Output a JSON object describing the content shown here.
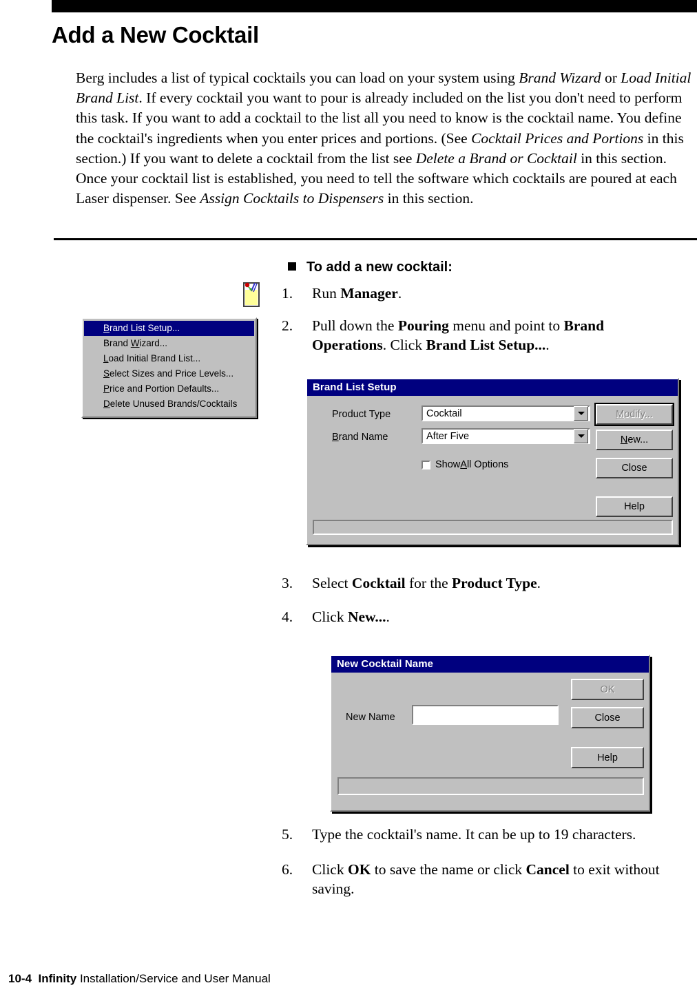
{
  "document": {
    "title": "Add a New Cocktail",
    "intro_segments": [
      {
        "text": "Berg includes a list of typical cocktails you can load on your system using ",
        "style": "normal"
      },
      {
        "text": "Brand Wizard",
        "style": "italic"
      },
      {
        "text": " or ",
        "style": "normal"
      },
      {
        "text": "Load Initial Brand List",
        "style": "italic"
      },
      {
        "text": ". If every cocktail you want to pour is already included on the list you don't need to perform this task. If you want to add a cocktail to the list all you need to know is the cocktail name. You define the cocktail's ingredients when you enter prices and portions. (See ",
        "style": "normal"
      },
      {
        "text": "Cocktail Prices and Portions",
        "style": "italic"
      },
      {
        "text": " in this section.) If you want to delete a cocktail from the list see ",
        "style": "normal"
      },
      {
        "text": "Delete a Brand or Cocktail",
        "style": "italic"
      },
      {
        "text": " in this section. Once your cocktail list is established, you need to tell the software which cocktails are poured at each Laser dispenser. See ",
        "style": "normal"
      },
      {
        "text": "Assign Cocktails to Dispensers",
        "style": "italic"
      },
      {
        "text": " in this section.",
        "style": "normal"
      }
    ]
  },
  "procedure": {
    "heading": "To add a new cocktail:",
    "steps": [
      {
        "number": "1.",
        "segments": [
          {
            "text": "Run ",
            "style": "normal"
          },
          {
            "text": "Manager",
            "style": "bold"
          },
          {
            "text": ".",
            "style": "normal"
          }
        ]
      },
      {
        "number": "2.",
        "segments": [
          {
            "text": "Pull down the ",
            "style": "normal"
          },
          {
            "text": "Pouring",
            "style": "bold"
          },
          {
            "text": " menu and point to ",
            "style": "normal"
          },
          {
            "text": "Brand Operations",
            "style": "bold"
          },
          {
            "text": ". Click ",
            "style": "normal"
          },
          {
            "text": "Brand List Setup...",
            "style": "bold"
          },
          {
            "text": ".",
            "style": "normal"
          }
        ]
      },
      {
        "number": "3.",
        "segments": [
          {
            "text": "Select ",
            "style": "normal"
          },
          {
            "text": "Cocktail",
            "style": "bold"
          },
          {
            "text": " for the ",
            "style": "normal"
          },
          {
            "text": "Product Type",
            "style": "bold"
          },
          {
            "text": ".",
            "style": "normal"
          }
        ]
      },
      {
        "number": "4.",
        "segments": [
          {
            "text": "Click ",
            "style": "normal"
          },
          {
            "text": "New...",
            "style": "bold"
          },
          {
            "text": ".",
            "style": "normal"
          }
        ]
      },
      {
        "number": "5.",
        "segments": [
          {
            "text": "Type the cocktail's name. It can be up to 19 characters.",
            "style": "normal"
          }
        ]
      },
      {
        "number": "6.",
        "segments": [
          {
            "text": "Click ",
            "style": "normal"
          },
          {
            "text": "OK",
            "style": "bold"
          },
          {
            "text": " to save the name or click ",
            "style": "normal"
          },
          {
            "text": "Cancel",
            "style": "bold"
          },
          {
            "text": " to exit without saving.",
            "style": "normal"
          }
        ]
      }
    ]
  },
  "menu_screenshot": {
    "items": [
      {
        "accel": "B",
        "rest": "rand List Setup...",
        "selected": true
      },
      {
        "pre": "Brand ",
        "accel": "W",
        "rest": "izard...",
        "selected": false
      },
      {
        "accel": "L",
        "rest": "oad Initial Brand List...",
        "selected": false
      },
      {
        "accel": "S",
        "rest": "elect Sizes and Price Levels...",
        "selected": false
      },
      {
        "accel": "P",
        "rest": "rice and Portion Defaults...",
        "selected": false
      },
      {
        "accel": "D",
        "rest": "elete Unused Brands/Cocktails",
        "selected": false
      }
    ]
  },
  "brand_list_setup_dialog": {
    "title": "Brand List Setup",
    "product_type_label": "Product Type",
    "product_type_value": "Cocktail",
    "brand_name_label_accel": "B",
    "brand_name_label_rest": "rand Name",
    "brand_name_value": "After Five",
    "show_all_options_pre": "Show ",
    "show_all_options_accel": "A",
    "show_all_options_rest": "ll Options",
    "buttons": {
      "modify_accel": "M",
      "modify_rest": "odify...",
      "new_accel": "N",
      "new_rest": "ew...",
      "close": "Close",
      "help": "Help"
    },
    "status_text": ""
  },
  "new_cocktail_dialog": {
    "title": "New Cocktail Name",
    "new_name_label": "New Name",
    "new_name_value": "",
    "buttons": {
      "ok": "OK",
      "close": "Close",
      "help": "Help"
    },
    "status_text": ""
  },
  "footer": {
    "page_number": "10-4",
    "product": "Infinity",
    "manual_title": "Installation/Service and User Manual"
  },
  "colors": {
    "titlebar_blue": "#00007f",
    "dialog_face": "#c0c0c0",
    "black_bar": "#000000",
    "glass_fill": "#ffff99",
    "cherry_red": "#cc0000",
    "straw_blue": "#3333cc"
  }
}
